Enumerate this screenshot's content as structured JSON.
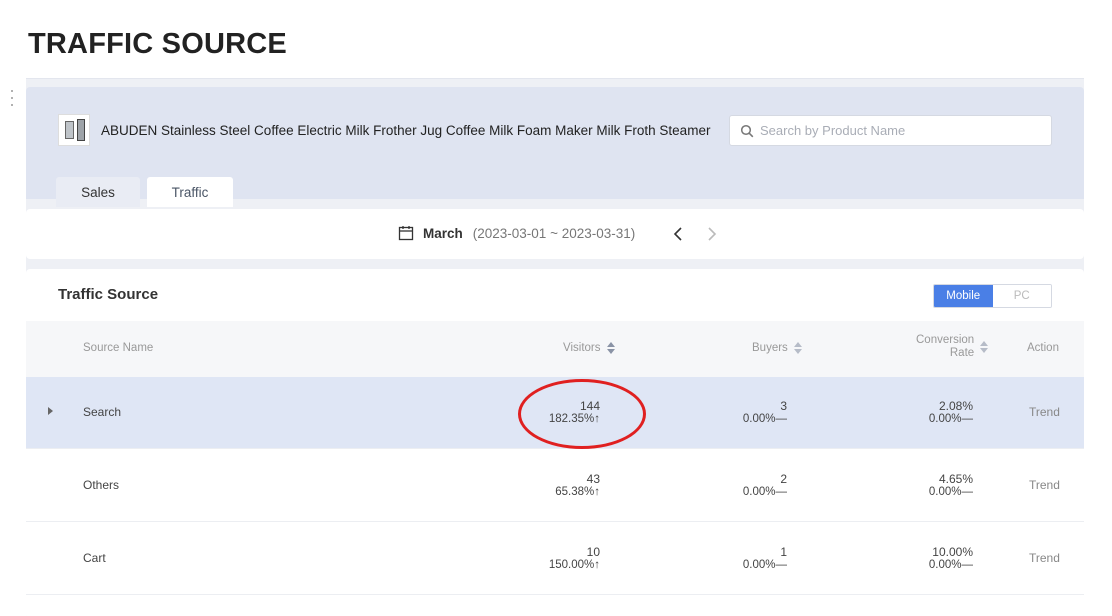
{
  "page": {
    "title": "TRAFFIC SOURCE"
  },
  "product": {
    "name": "ABUDEN Stainless Steel Coffee Electric Milk Frother Jug Coffee Milk Foam Maker Milk Froth Steamer",
    "search_placeholder": "Search by Product Name"
  },
  "tabs": [
    {
      "label": "Sales",
      "active": false
    },
    {
      "label": "Traffic",
      "active": true
    }
  ],
  "date": {
    "month": "March",
    "range": "(2023-03-01 ~ 2023-03-31)"
  },
  "traffic": {
    "title": "Traffic Source",
    "toggle": [
      {
        "label": "Mobile",
        "active": true
      },
      {
        "label": "PC",
        "active": false
      }
    ],
    "columns": {
      "source": "Source Name",
      "visitors": "Visitors",
      "buyers": "Buyers",
      "conversion_line1": "Conversion",
      "conversion_line2": "Rate",
      "action": "Action"
    },
    "rows": [
      {
        "source": "Search",
        "visitors": "144",
        "visitors_change": "182.35%↑",
        "buyers": "3",
        "buyers_change": "0.00%—",
        "conversion": "2.08%",
        "conversion_change": "0.00%—",
        "action": "Trend"
      },
      {
        "source": "Others",
        "visitors": "43",
        "visitors_change": "65.38%↑",
        "buyers": "2",
        "buyers_change": "0.00%—",
        "conversion": "4.65%",
        "conversion_change": "0.00%—",
        "action": "Trend"
      },
      {
        "source": "Cart",
        "visitors": "10",
        "visitors_change": "150.00%↑",
        "buyers": "1",
        "buyers_change": "0.00%—",
        "conversion": "10.00%",
        "conversion_change": "0.00%—",
        "action": "Trend"
      }
    ]
  },
  "colors": {
    "accent": "#4a7fe6",
    "header_bg": "#dfe4f1",
    "selected_row": "#dfe6f5",
    "annotation": "#e02020"
  }
}
